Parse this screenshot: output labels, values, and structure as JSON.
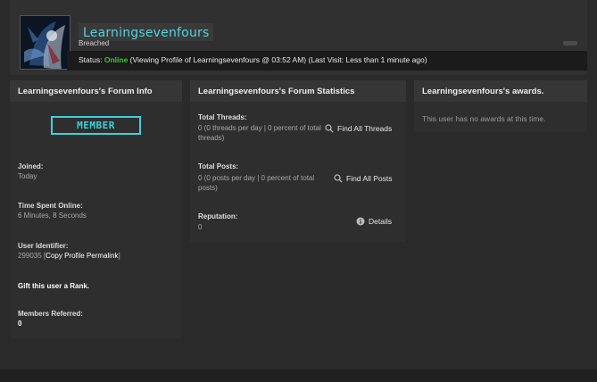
{
  "profile": {
    "username": "Learningsevenfours",
    "usergroup": "Breached",
    "status_label": "Status:",
    "status_online": "Online",
    "status_rest": "(Viewing Profile of Learningsevenfours @ 03:52 AM) (Last Visit: Less than 1 minute ago)"
  },
  "forum_info": {
    "title": "Learningsevenfours's Forum Info",
    "rank_badge": "MEMBER",
    "joined_label": "Joined:",
    "joined_value": "Today",
    "time_online_label": "Time Spent Online:",
    "time_online_value": "6 Minutes, 8 Seconds",
    "user_id_label": "User Identifier:",
    "user_id_value": "299035",
    "permalink_open": "[",
    "permalink_text": "Copy Profile Permalink",
    "permalink_close": "]",
    "gift_rank": "Gift this user a Rank.",
    "referred_label": "Members Referred:",
    "referred_value": "0"
  },
  "forum_stats": {
    "title": "Learningsevenfours's Forum Statistics",
    "threads_label": "Total Threads:",
    "threads_value": "0 (0 threads per day | 0 percent of total threads)",
    "find_threads": "Find All Threads",
    "posts_label": "Total Posts:",
    "posts_value": "0 (0 posts per day | 0 percent of total posts)",
    "find_posts": "Find All Posts",
    "reputation_label": "Reputation:",
    "reputation_value": "0",
    "details": "Details"
  },
  "awards": {
    "title": "Learningsevenfours's awards.",
    "empty_text": "This user has no awards at this time."
  },
  "icons": {
    "search": "search-icon",
    "info": "info-icon"
  },
  "colors": {
    "accent": "#3fd0dc",
    "online": "#3cc43c",
    "background": "#2a2a2a",
    "panel": "#2e2e2e"
  }
}
